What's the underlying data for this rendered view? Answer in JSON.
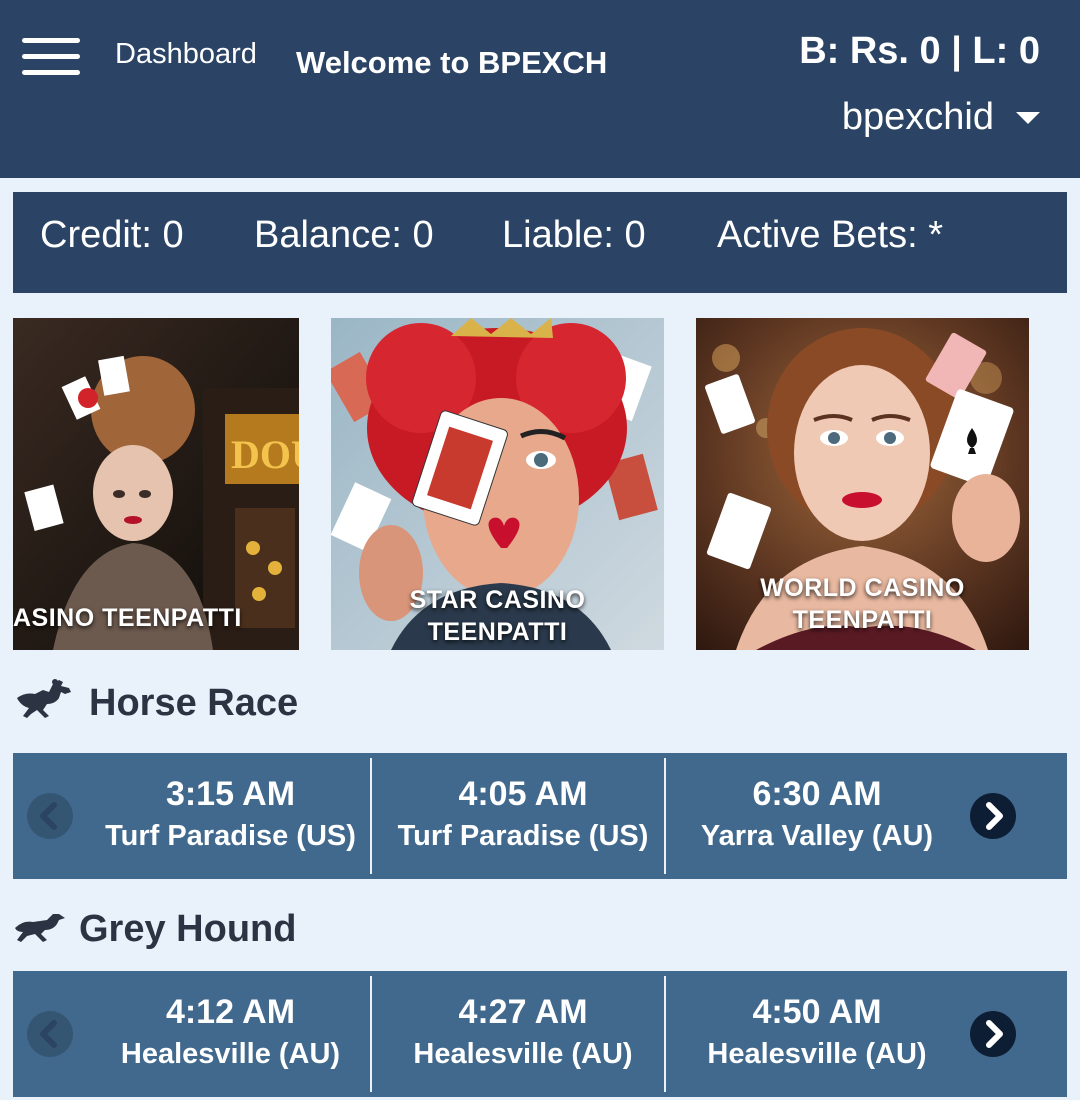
{
  "header": {
    "menu_icon": "hamburger-menu-icon",
    "dashboard_label": "Dashboard",
    "welcome_text": "Welcome to BPEXCH",
    "balance_liability": "B: Rs. 0 | L: 0",
    "username": "bpexchid",
    "username_caret_icon": "caret-down-icon"
  },
  "stats": {
    "credit": "Credit: 0",
    "balance": "Balance: 0",
    "liable": "Liable: 0",
    "active_bets": "Active Bets: *"
  },
  "casino_tiles": [
    {
      "label": "ASINO TEENPATTI"
    },
    {
      "label_line1": "STAR CASINO",
      "label_line2": "TEENPATTI"
    },
    {
      "label_line1": "WORLD CASINO",
      "label_line2": "TEENPATTI"
    }
  ],
  "horse_race": {
    "title": "Horse Race",
    "icon": "horse-racing-icon",
    "races": [
      {
        "time": "3:15 AM",
        "venue": "Turf Paradise (US)"
      },
      {
        "time": "4:05 AM",
        "venue": "Turf Paradise (US)"
      },
      {
        "time": "6:30 AM",
        "venue": "Yarra Valley (AU)"
      }
    ]
  },
  "grey_hound": {
    "title": "Grey Hound",
    "icon": "greyhound-icon",
    "races": [
      {
        "time": "4:12 AM",
        "venue": "Healesville (AU)"
      },
      {
        "time": "4:27 AM",
        "venue": "Healesville (AU)"
      },
      {
        "time": "4:50 AM",
        "venue": "Healesville (AU)"
      }
    ]
  },
  "colors": {
    "header_bg": "#2b4465",
    "page_bg": "#e9f1fb",
    "race_strip_bg": "#41698d",
    "title_text": "#2c3444"
  }
}
